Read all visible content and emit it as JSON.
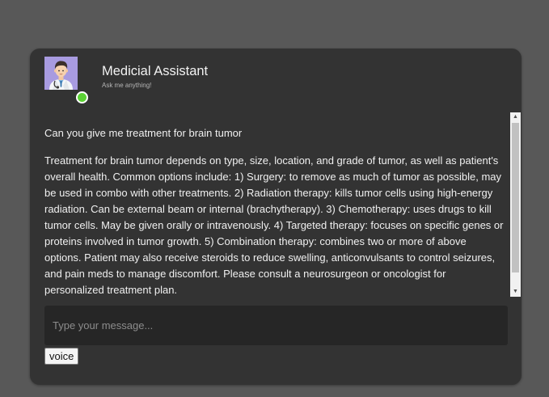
{
  "header": {
    "title": "Medicial Assistant",
    "subtitle": "Ask me anything!",
    "avatar_icon": "doctor-avatar-icon",
    "status_color": "#5bd235"
  },
  "messages": [
    {
      "role": "user",
      "text": "Can you give me treatment for brain tumor"
    },
    {
      "role": "assistant",
      "text": "Treatment for brain tumor depends on type, size, location, and grade of tumor, as well as patient's overall health. Common options include: 1) Surgery: to remove as much of tumor as possible, may be used in combo with other treatments. 2) Radiation therapy: kills tumor cells using high-energy radiation. Can be external beam or internal (brachytherapy). 3) Chemotherapy: uses drugs to kill tumor cells. May be given orally or intravenously. 4) Targeted therapy: focuses on specific genes or proteins involved in tumor growth. 5) Combination therapy: combines two or more of above options. Patient may also receive steroids to reduce swelling, anticonvulsants to control seizures, and pain meds to manage discomfort. Please consult a neurosurgeon or oncologist for personalized treatment plan."
    }
  ],
  "composer": {
    "placeholder": "Type your message...",
    "value": "",
    "voice_label": "voice"
  },
  "colors": {
    "page_background": "#585858",
    "card_background": "#333333",
    "input_background": "#262626"
  }
}
